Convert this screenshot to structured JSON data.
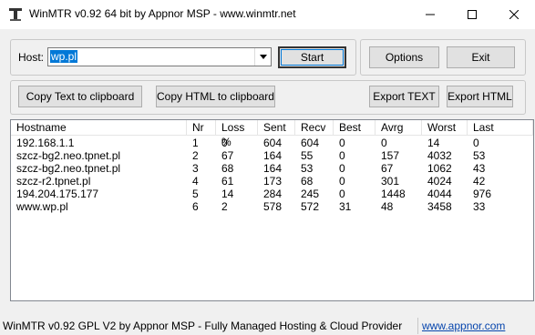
{
  "window": {
    "title": "WinMTR v0.92 64 bit by Appnor MSP - www.winmtr.net"
  },
  "controls": {
    "host_label": "Host:",
    "host_value": "wp.pl",
    "start_label": "Start",
    "options_label": "Options",
    "exit_label": "Exit",
    "copy_text_label": "Copy Text to clipboard",
    "copy_html_label": "Copy HTML to clipboard",
    "export_text_label": "Export TEXT",
    "export_html_label": "Export HTML"
  },
  "table": {
    "columns": [
      "Hostname",
      "Nr",
      "Loss %",
      "Sent",
      "Recv",
      "Best",
      "Avrg",
      "Worst",
      "Last"
    ],
    "rows": [
      [
        "192.168.1.1",
        "1",
        "0",
        "604",
        "604",
        "0",
        "0",
        "14",
        "0"
      ],
      [
        "szcz-bg2.neo.tpnet.pl",
        "2",
        "67",
        "164",
        "55",
        "0",
        "157",
        "4032",
        "53"
      ],
      [
        "szcz-bg2.neo.tpnet.pl",
        "3",
        "68",
        "164",
        "53",
        "0",
        "67",
        "1062",
        "43"
      ],
      [
        "szcz-r2.tpnet.pl",
        "4",
        "61",
        "173",
        "68",
        "0",
        "301",
        "4024",
        "42"
      ],
      [
        "194.204.175.177",
        "5",
        "14",
        "284",
        "245",
        "0",
        "1448",
        "4044",
        "976"
      ],
      [
        "www.wp.pl",
        "6",
        "2",
        "578",
        "572",
        "31",
        "48",
        "3458",
        "33"
      ]
    ]
  },
  "status": {
    "text": "WinMTR v0.92 GPL V2 by Appnor MSP - Fully Managed Hosting & Cloud Provider",
    "link": "www.appnor.com"
  }
}
